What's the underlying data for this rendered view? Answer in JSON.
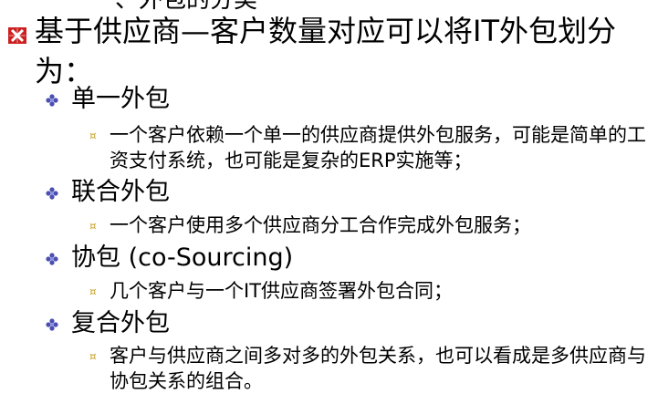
{
  "cut_top_text": "一、外包的分类",
  "heading": "基于供应商—客户数量对应可以将IT外包划分为：",
  "items": [
    {
      "label": "单一外包",
      "detail": "一个客户依赖一个单一的供应商提供外包服务，可能是简单的工资支付系统，也可能是复杂的ERP实施等；"
    },
    {
      "label": "联合外包",
      "detail": "一个客户使用多个供应商分工合作完成外包服务；"
    },
    {
      "label": "协包 (co-Sourcing)",
      "detail": "几个客户与一个IT供应商签署外包合同；"
    },
    {
      "label": "复合外包",
      "detail": "客户与供应商之间多对多的外包关系，也可以看成是多供应商与协包关系的组合。"
    }
  ],
  "colors": {
    "l1_bullet": "#cc1f1f",
    "l2_bullet": "#4a4fb0",
    "l3_bullet": "#c9a227"
  },
  "icons": {
    "l1": "red-x-square-icon",
    "l2": "blue-flower-icon",
    "l3": "yellow-square-icon"
  }
}
